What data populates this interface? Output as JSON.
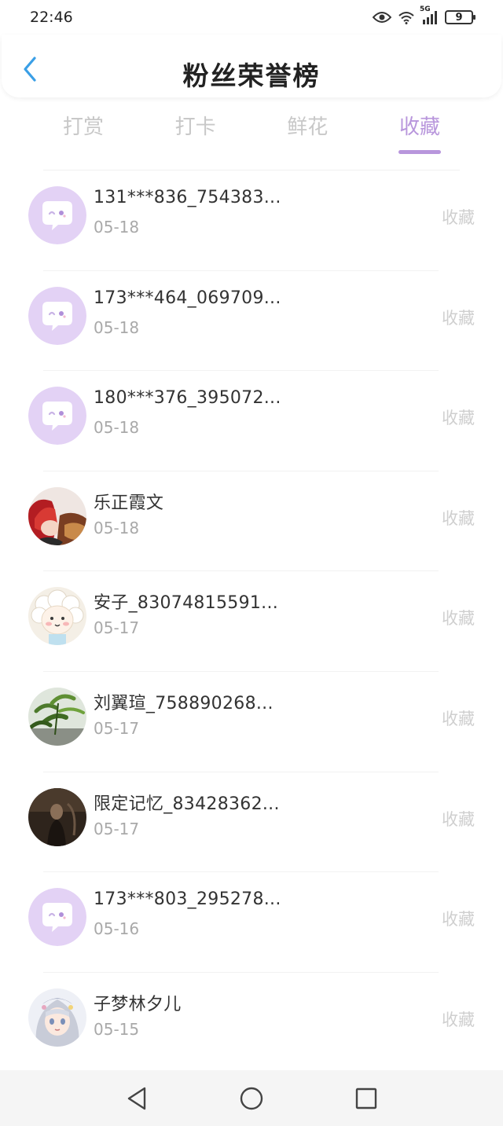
{
  "status_bar": {
    "time": "22:46",
    "signal": "5G",
    "battery": "9"
  },
  "header": {
    "title": "粉丝荣誉榜"
  },
  "tabs": [
    {
      "label": "打赏",
      "active": false
    },
    {
      "label": "打卡",
      "active": false
    },
    {
      "label": "鲜花",
      "active": false
    },
    {
      "label": "收藏",
      "active": true
    }
  ],
  "colors": {
    "accent": "#b896dc",
    "default_avatar_bg": "#e3d2f5"
  },
  "list": [
    {
      "name": "131***836_754383...",
      "date": "05-18",
      "action": "收藏",
      "avatar": "default-avatar-icon"
    },
    {
      "name": "173***464_069709...",
      "date": "05-18",
      "action": "收藏",
      "avatar": "default-avatar-icon"
    },
    {
      "name": "180***376_395072...",
      "date": "05-18",
      "action": "收藏",
      "avatar": "default-avatar-icon"
    },
    {
      "name": "乐正霞文",
      "date": "05-18",
      "action": "收藏",
      "avatar": "anime-red-hair-avatar"
    },
    {
      "name": "安子_83074815591...",
      "date": "05-17",
      "action": "收藏",
      "avatar": "cartoon-sheep-avatar"
    },
    {
      "name": "刘翼瑄_758890268...",
      "date": "05-17",
      "action": "收藏",
      "avatar": "bamboo-plant-avatar"
    },
    {
      "name": "限定记忆_83428362...",
      "date": "05-17",
      "action": "收藏",
      "avatar": "dark-photo-avatar"
    },
    {
      "name": "173***803_295278...",
      "date": "05-16",
      "action": "收藏",
      "avatar": "default-avatar-icon"
    },
    {
      "name": "子梦林夕儿",
      "date": "05-15",
      "action": "收藏",
      "avatar": "anime-girl-avatar"
    }
  ]
}
